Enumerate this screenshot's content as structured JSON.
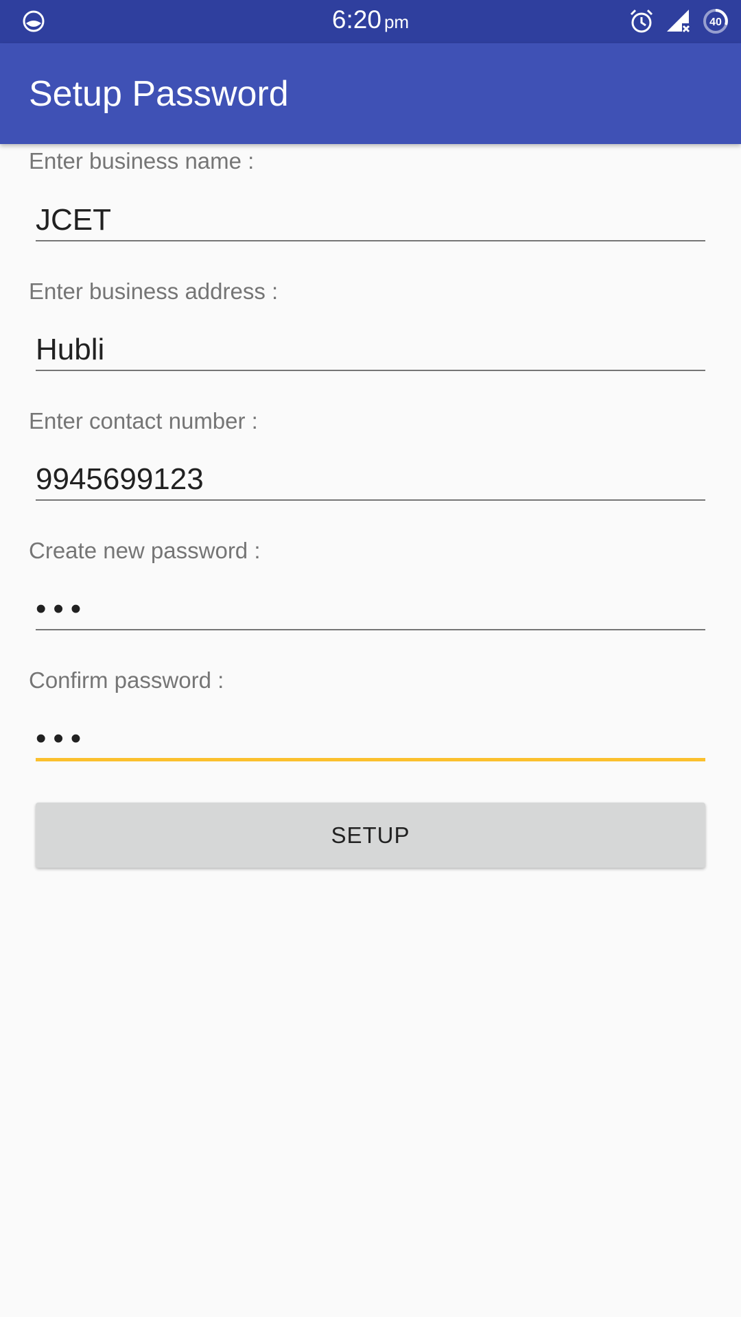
{
  "status_bar": {
    "time": "6:20",
    "ampm": "pm",
    "battery_level": "40",
    "icons": [
      "app-notification-icon",
      "alarm-icon",
      "signal-no-data-icon",
      "battery-icon"
    ]
  },
  "app_bar": {
    "title": "Setup Password",
    "color": "#3f51b5"
  },
  "form": {
    "business_name": {
      "label": "Enter business name :",
      "value": "JCET"
    },
    "business_address": {
      "label": "Enter business address :",
      "value": "Hubli"
    },
    "contact_number": {
      "label": "Enter contact number :",
      "value": "9945699123"
    },
    "new_password": {
      "label": "Create new password :",
      "value": "•••"
    },
    "confirm_password": {
      "label": "Confirm password :",
      "value": "•••"
    },
    "focus_color": "#fbc02d"
  },
  "setup_button": {
    "label": "SETUP"
  }
}
